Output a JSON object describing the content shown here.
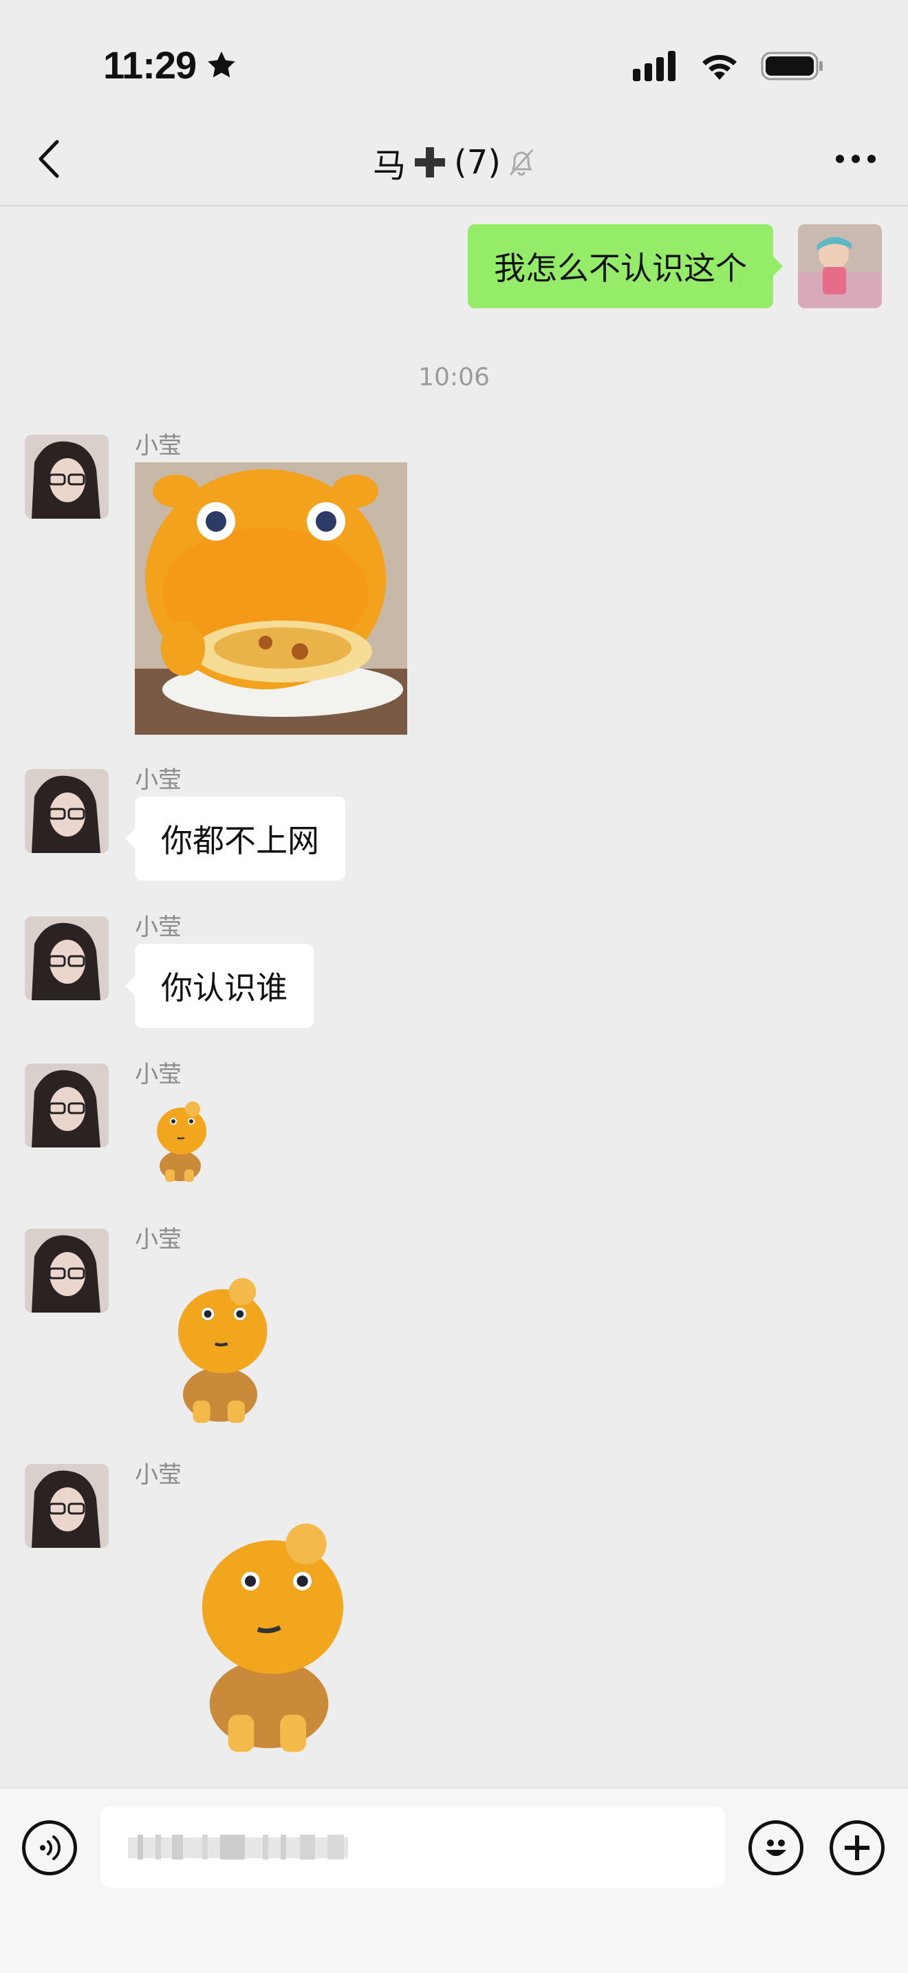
{
  "status_bar": {
    "time": "11:29"
  },
  "header": {
    "title": "马",
    "member_count": "(7)"
  },
  "messages": {
    "outgoing_text": "我怎么不认识这个",
    "timestamp": "10:06",
    "sender_name": "小莹",
    "text_1": "你都不上网",
    "text_2": "你认识谁"
  },
  "colors": {
    "outgoing_bubble": "#95ec69",
    "incoming_bubble": "#ffffff",
    "background": "#ededed",
    "sticker_orange": "#f5a623"
  }
}
